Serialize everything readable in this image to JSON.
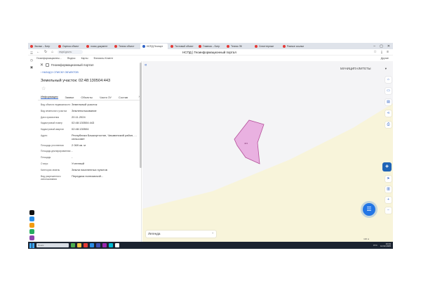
{
  "browser": {
    "tabs": [
      {
        "label": "Звонки – Битр",
        "color": "#e53935"
      },
      {
        "label": "Оценка объект",
        "color": "#e53935"
      },
      {
        "label": "поиск документ",
        "color": "#e53935"
      },
      {
        "label": "Техник объект",
        "color": "#e53935"
      },
      {
        "label": "НСПД Геопорт",
        "color": "#2f62c6",
        "active": true
      },
      {
        "label": "Тестовый объект",
        "color": "#e53935"
      },
      {
        "label": "Главная – Битр",
        "color": "#e53935"
      },
      {
        "label": "Техник ЛК",
        "color": "#e53935"
      },
      {
        "label": "Сплиттерные",
        "color": "#e53935"
      },
      {
        "label": "Разные ссылки",
        "color": "#e53935"
      }
    ],
    "address_url": "nspd.gov.ru",
    "page_title": "НСПД | Геоинформационный портал",
    "bookmarks": [
      {
        "label": "Геоинформационны..."
      },
      {
        "label": "Яндекс"
      },
      {
        "label": "Карты"
      },
      {
        "label": "Филиалы Клиент"
      }
    ],
    "bookmarks_more": "Другие"
  },
  "panel": {
    "header_title": "Геоинформационный портал",
    "back_link": "НАЗАД К СПИСКУ ОБЪЕКТОВ",
    "parcel_title": "Земельный участок: 02:48:130504:443",
    "tabs": [
      "Информация",
      "Заявки",
      "Объекты",
      "Части ЗУ",
      "Состав"
    ],
    "active_tab": 0,
    "rows": [
      {
        "label": "Вид объекта недвижимости",
        "value": "Земельный участок"
      },
      {
        "label": "Вид земельного участка",
        "value": "Землепользование"
      },
      {
        "label": "Дата присвоения",
        "value": "20.11.2024"
      },
      {
        "label": "Кадастровый номер",
        "value": "02:48:130504:443"
      },
      {
        "label": "Кадастровый квартал",
        "value": "02:48:130504"
      },
      {
        "label": "Адрес",
        "value": "Республика Башкортостан, Чишминский район, ... сельсовет"
      },
      {
        "label": "Площадь уточненная",
        "value": "2 069 кв. м"
      },
      {
        "label": "Площадь декларированная",
        "value": "-"
      },
      {
        "label": "Площадь",
        "value": "-"
      },
      {
        "label": "Статус",
        "value": "Учтенный"
      },
      {
        "label": "Категория земель",
        "value": "Земли населенных пунктов"
      },
      {
        "label": "Вид разрешенного использования",
        "value": "Передача полномочий..."
      }
    ]
  },
  "map": {
    "layer_select": "МУНИЦИПАЛИТЕТЫ",
    "legend": "Легенда",
    "parcel_label": "443",
    "scale": "100 м",
    "colors": {
      "zone_fill": "#f8f4da",
      "parcel_fill": "#e9b1e1",
      "parcel_stroke": "#b4509a",
      "accent": "#2f62c6"
    },
    "tools_top": [
      "home-icon",
      "measure-icon",
      "print-icon",
      "share-icon",
      "print-icon-2"
    ],
    "tools_bottom": [
      "locate-icon",
      "stats-icon",
      "zoom-in-icon",
      "zoom-out-icon"
    ]
  },
  "taskbar": {
    "search_placeholder": "Поиск",
    "tray_lang": "РУС",
    "time": "19:33",
    "date": "14.02.2025"
  }
}
